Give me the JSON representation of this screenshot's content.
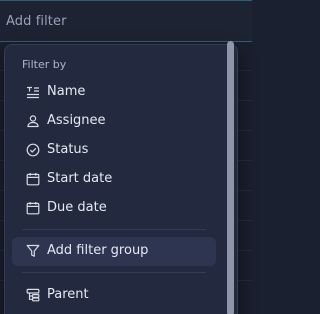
{
  "filter_field": {
    "placeholder": "Add filter"
  },
  "dropdown": {
    "section_label": "Filter by",
    "items": [
      {
        "label": "Name",
        "icon": "text-lines-icon"
      },
      {
        "label": "Assignee",
        "icon": "user-icon"
      },
      {
        "label": "Status",
        "icon": "check-circle-icon"
      },
      {
        "label": "Start date",
        "icon": "calendar-icon"
      },
      {
        "label": "Due date",
        "icon": "calendar-icon"
      }
    ],
    "group_action": {
      "label": "Add filter group",
      "icon": "funnel-icon"
    },
    "extra_items": [
      {
        "label": "Parent",
        "icon": "hierarchy-icon"
      }
    ]
  },
  "colors": {
    "background": "#1a1f2e",
    "dropdown": "#232a3f",
    "hover": "#2e3550",
    "text": "#e6e9f2",
    "muted": "#aeb5c8",
    "field_border": "#2f5f73",
    "scrollbar": "#8e96a8"
  }
}
